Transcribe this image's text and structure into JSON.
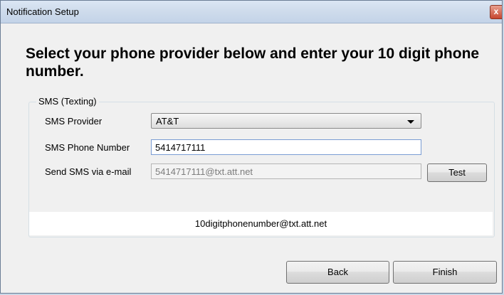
{
  "window": {
    "title": "Notification Setup",
    "close_glyph": "x"
  },
  "heading": "Select your phone provider below and enter your 10 digit phone number.",
  "sms_group": {
    "legend": "SMS (Texting)",
    "provider_label": "SMS Provider",
    "provider_value": "AT&T",
    "phone_label": "SMS Phone Number",
    "phone_value": "5414717111",
    "email_label": "Send SMS via e-mail",
    "email_value": "5414717111@txt.att.net",
    "test_label": "Test",
    "format_hint": "10digitphonenumber@txt.att.net"
  },
  "buttons": {
    "back": "Back",
    "finish": "Finish"
  },
  "colors": {
    "title_bar": "#cfdcec",
    "close_button": "#c7462f",
    "focus_border": "#7a9cd3"
  }
}
